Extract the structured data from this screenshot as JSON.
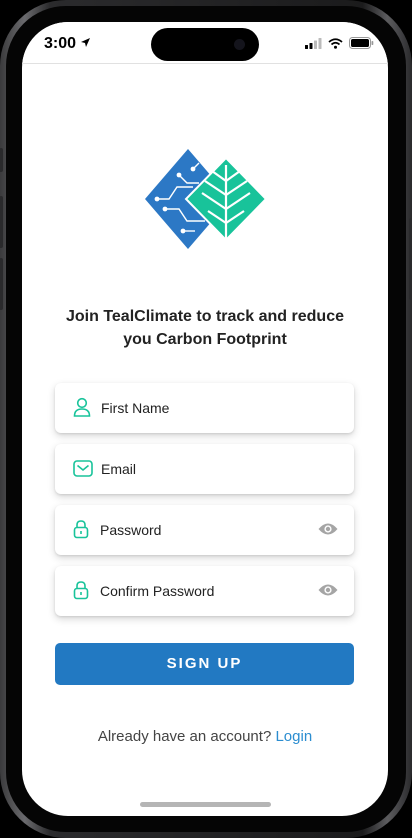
{
  "status_bar": {
    "time": "3:00"
  },
  "heading": {
    "line1": "Join TealClimate to track and reduce",
    "line2": "you Carbon Footprint"
  },
  "form": {
    "first_name_placeholder": "First Name",
    "email_placeholder": "Email",
    "password_placeholder": "Password",
    "confirm_password_placeholder": "Confirm Password"
  },
  "signup_button": {
    "label": "SIGN UP"
  },
  "login_prompt": {
    "text": "Already have an account?",
    "link": "Login"
  },
  "colors": {
    "primary_blue": "#2279c2",
    "accent_green": "#18c39a",
    "logo_blue": "#2c78c5",
    "link_blue": "#2b8dd0"
  }
}
